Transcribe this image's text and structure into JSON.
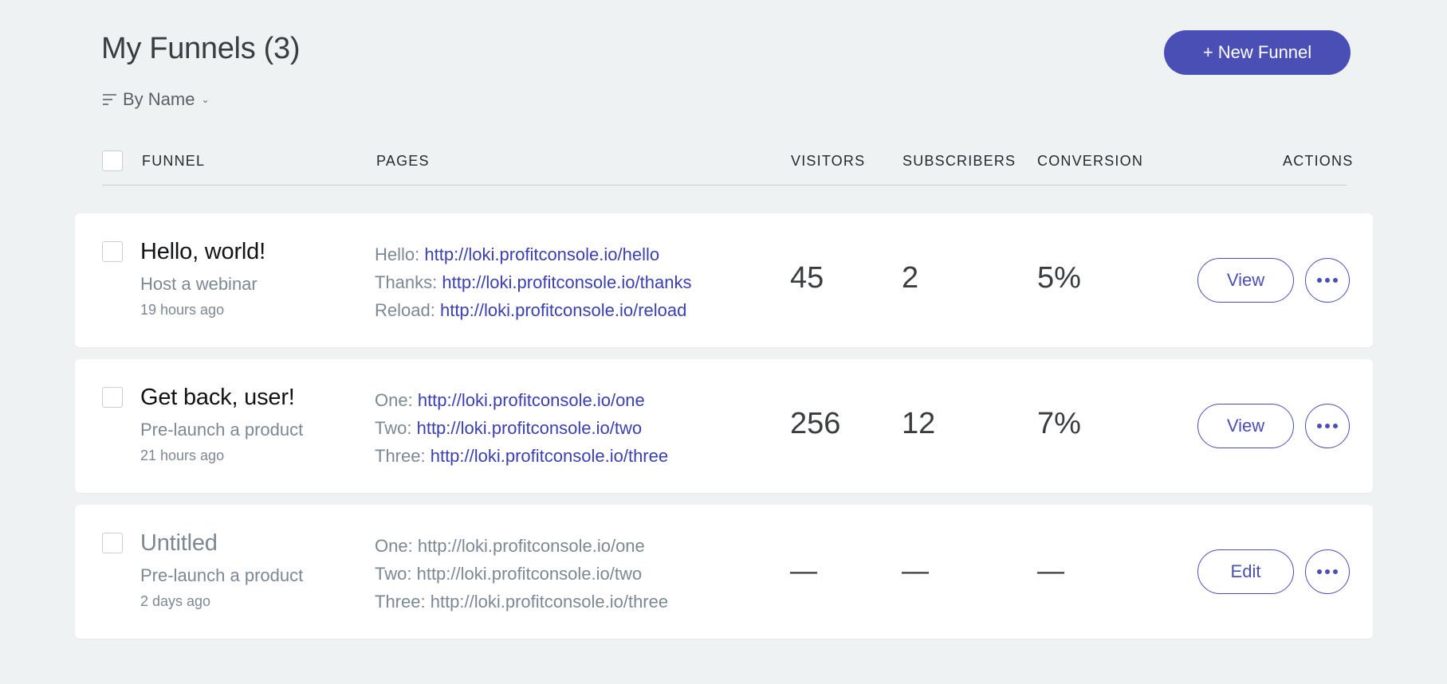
{
  "header": {
    "title": "My Funnels (3)",
    "new_button": "+ New Funnel",
    "sort_label": "By Name",
    "sort_chevron": "⌄"
  },
  "columns": {
    "funnel": "FUNNEL",
    "pages": "PAGES",
    "visitors": "VISITORS",
    "subscribers": "SUBSCRIBERS",
    "conversion": "CONVERSION",
    "actions": "ACTIONS"
  },
  "funnels": [
    {
      "name": "Hello, world!",
      "type": "Host a webinar",
      "age": "19 hours ago",
      "pages": [
        {
          "label": "Hello:",
          "url": "http://loki.profitconsole.io/hello"
        },
        {
          "label": "Thanks:",
          "url": "http://loki.profitconsole.io/thanks"
        },
        {
          "label": "Reload:",
          "url": "http://loki.profitconsole.io/reload"
        }
      ],
      "visitors": "45",
      "subscribers": "2",
      "conversion": "5%",
      "action": "View"
    },
    {
      "name": "Get back, user!",
      "type": "Pre-launch a product",
      "age": "21 hours ago",
      "pages": [
        {
          "label": "One:",
          "url": "http://loki.profitconsole.io/one"
        },
        {
          "label": "Two:",
          "url": "http://loki.profitconsole.io/two"
        },
        {
          "label": "Three:",
          "url": "http://loki.profitconsole.io/three"
        }
      ],
      "visitors": "256",
      "subscribers": "12",
      "conversion": "7%",
      "action": "View"
    },
    {
      "name": "Untitled",
      "type": "Pre-launch a product",
      "age": "2 days ago",
      "pages": [
        {
          "label": "One:",
          "url": "http://loki.profitconsole.io/one"
        },
        {
          "label": "Two:",
          "url": "http://loki.profitconsole.io/two"
        },
        {
          "label": "Three:",
          "url": "http://loki.profitconsole.io/three"
        }
      ],
      "visitors": "—",
      "subscribers": "—",
      "conversion": "—",
      "action": "Edit"
    }
  ],
  "colors": {
    "accent": "#4a4fb5",
    "link": "#3b40b0",
    "muted_text": "#7c8893",
    "background": "#eff2f3"
  },
  "icons": {
    "sort": "sort-lines-icon",
    "more": "more-dots-icon"
  }
}
